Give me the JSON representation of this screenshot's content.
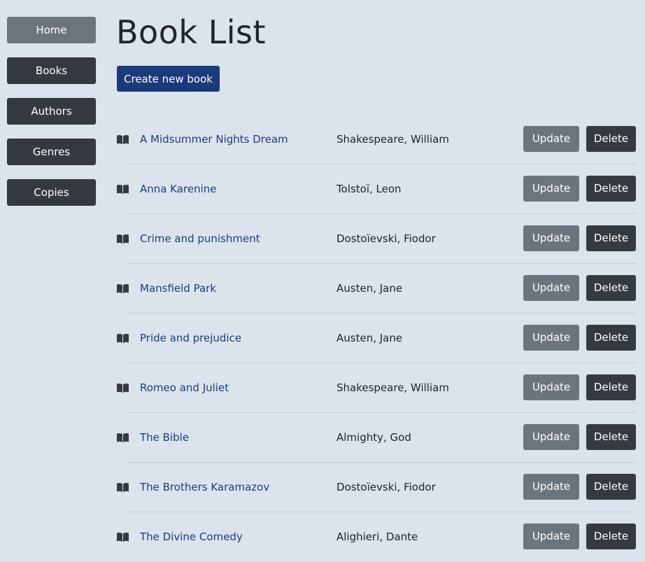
{
  "sidebar": {
    "items": [
      {
        "label": "Home",
        "active": true
      },
      {
        "label": "Books",
        "active": false
      },
      {
        "label": "Authors",
        "active": false
      },
      {
        "label": "Genres",
        "active": false
      },
      {
        "label": "Copies",
        "active": false
      }
    ]
  },
  "main": {
    "title": "Book List",
    "create_label": "Create new book",
    "update_label": "Update",
    "delete_label": "Delete",
    "book_icon": "book-open-icon",
    "books": [
      {
        "title": "A Midsummer Nights Dream",
        "author": "Shakespeare, William"
      },
      {
        "title": "Anna Karenine",
        "author": "Tolstoï, Leon"
      },
      {
        "title": "Crime and punishment",
        "author": "Dostoïevski, Fiodor"
      },
      {
        "title": "Mansfield Park",
        "author": "Austen, Jane"
      },
      {
        "title": "Pride and prejudice",
        "author": "Austen, Jane"
      },
      {
        "title": "Romeo and Juliet",
        "author": "Shakespeare, William"
      },
      {
        "title": "The Bible",
        "author": "Almighty, God"
      },
      {
        "title": "The Brothers Karamazov",
        "author": "Dostoïevski, Fiodor"
      },
      {
        "title": "The Divine Comedy",
        "author": "Alighieri, Dante"
      }
    ]
  },
  "colors": {
    "background": "#dbe3ec",
    "nav_button": "#343a40",
    "nav_active": "#6c757d",
    "primary": "#1b3a7a",
    "link": "#1e3d78",
    "update_button": "#6c757d",
    "delete_button": "#343a40"
  }
}
